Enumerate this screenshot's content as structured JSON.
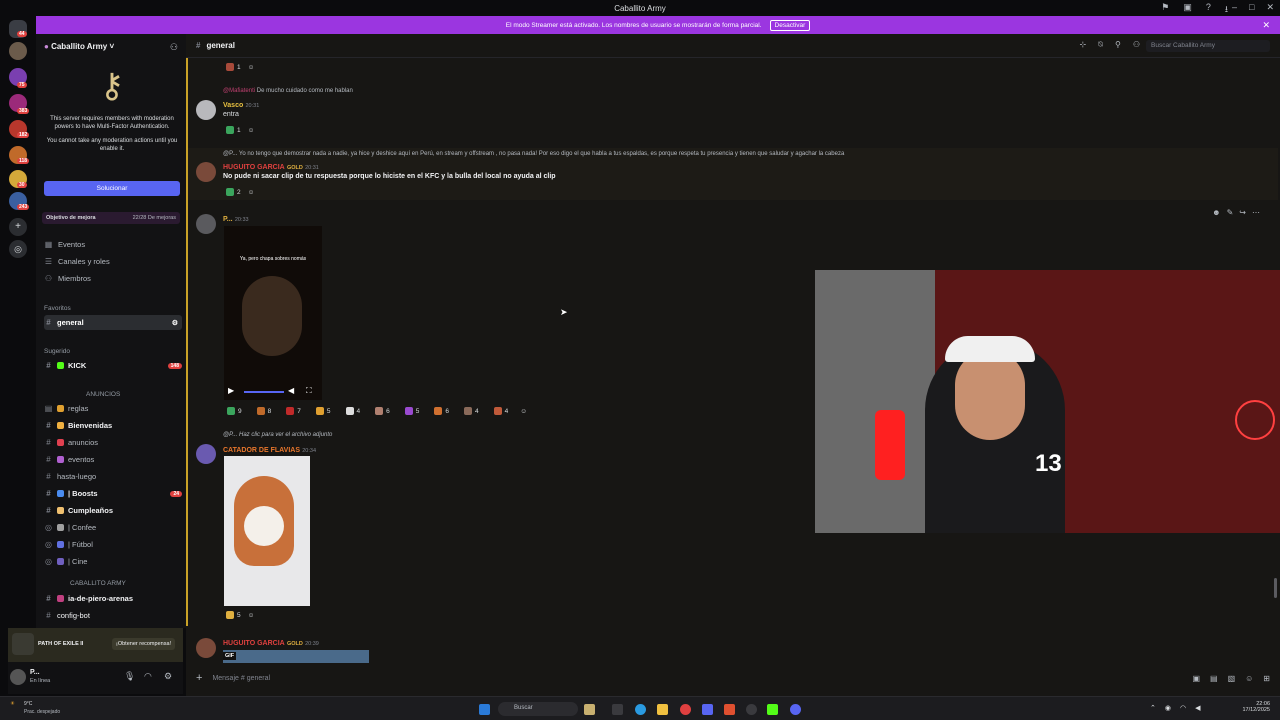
{
  "window": {
    "title": "Caballito Army"
  },
  "banner": {
    "text": "El modo Streamer está activado. Los nombres de usuario se mostrarán de forma parcial.",
    "button": "Desactivar"
  },
  "rail": {
    "badges": [
      "44",
      "75",
      "383",
      "182",
      "118",
      "30",
      "243"
    ]
  },
  "server": {
    "name": "Caballito Army"
  },
  "mfa": {
    "line1": "This server requires members with moderation powers to have Multi-Factor Authentication.",
    "line2": "You cannot take any moderation actions until you enable it.",
    "button": "Solucionar"
  },
  "goal": {
    "label": "Objetivo de mejora",
    "value": "22/28 De mejoras"
  },
  "nav": [
    {
      "label": "Eventos",
      "icon": "calendar-icon"
    },
    {
      "label": "Canales y roles",
      "icon": "list-icon"
    },
    {
      "label": "Miembros",
      "icon": "members-icon"
    }
  ],
  "sections": {
    "favoritos": "Favoritos",
    "sugerido": "Sugerido",
    "anuncios": "ANUNCIOS",
    "army": "CABALLITO ARMY"
  },
  "favorite_channel": "general",
  "suggested": {
    "label": "KICK",
    "count": "148"
  },
  "channels": [
    {
      "label": "reglas",
      "bold": false
    },
    {
      "label": "Bienvenidas",
      "bold": true
    },
    {
      "label": "anuncios",
      "bold": false
    },
    {
      "label": "eventos",
      "bold": false
    },
    {
      "label": "hasta-luego",
      "bold": false
    },
    {
      "label": "| Boosts",
      "bold": true,
      "count": "24"
    },
    {
      "label": "Cumpleaños",
      "bold": true
    },
    {
      "label": "| Confee",
      "bold": false
    },
    {
      "label": "| Fútbol",
      "bold": false
    },
    {
      "label": "| Cine",
      "bold": false
    }
  ],
  "army_channels": [
    {
      "label": "ia-de-piero-arenas"
    },
    {
      "label": "config-bot"
    }
  ],
  "activity": {
    "game": "PATH OF EXILE II",
    "button": "¡Obtener recompensa!"
  },
  "user": {
    "name": "P...",
    "status": "En línea"
  },
  "header": {
    "channel": "general",
    "search_placeholder": "Buscar Caballito Army"
  },
  "messages": {
    "m0": {
      "react_count": "1"
    },
    "m1": {
      "reply_name": "@Mafiatenti",
      "reply_text": "De mucho cuidado como me hablan",
      "name": "Vasco",
      "time": "20:31",
      "text": "entra",
      "react_count": "1"
    },
    "m2": {
      "reply_text": "@P... Yo no tengo que demostrar nada a nadie, ya hice y deshice aquí en Perú, en stream y offstream , no pasa nada! Por eso digo el que habla a tus espaldas, es porque respeta tu presencia y tienen que saludar y agachar la cabeza",
      "name": "HUGUITO GARCIA",
      "tag": "GOLD",
      "time": "20:31",
      "text": "No pude ni sacar clip de tu respuesta porque lo hiciste en el KFC y la bulla del local no ayuda al clip",
      "react_count": "2"
    },
    "m3": {
      "name": "P...",
      "time": "20:33",
      "video_caption": "Ya, pero chapa sobres nomás",
      "reactions": [
        "9",
        "8",
        "7",
        "5",
        "4",
        "6",
        "5",
        "6",
        "4",
        "4"
      ]
    },
    "m4": {
      "reply_text": "@P... Haz clic para ver el archivo adjunto",
      "name": "CATADOR DE FLAVIAS",
      "time": "20:34",
      "react_count": "5"
    },
    "m5": {
      "name": "HUGUITO GARCIA",
      "tag": "GOLD",
      "time": "20:39",
      "gif": "GIF"
    }
  },
  "composer": {
    "placeholder": "Mensaje #",
    "channel": "general"
  },
  "taskbar": {
    "weather_temp": "9°C",
    "weather_desc": "Prac. despejado",
    "search": "Buscar",
    "time": "22:06",
    "date": "17/12/2025"
  },
  "colors": {
    "accent": "#5865f2",
    "banner": "#9b36e0",
    "mention": "#e0413f",
    "gold_name": "#e8762c"
  }
}
